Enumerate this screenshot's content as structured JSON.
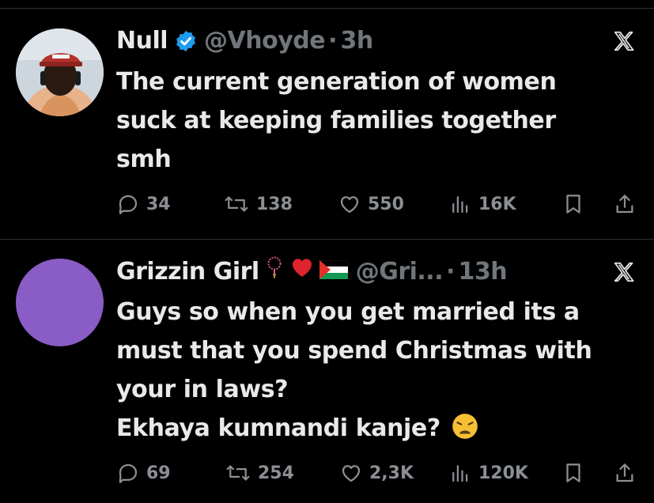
{
  "colors": {
    "background": "#000000",
    "text": "#e7e9ea",
    "muted": "#71767b",
    "verified": "#1d9bf0",
    "divider": "#2f3336",
    "avatar2": "#8a5cc6"
  },
  "tweets": [
    {
      "name": "Null",
      "verified": true,
      "handle": "@Vhoyde",
      "separator": "·",
      "time": "3h",
      "body": [
        "The current generation of women",
        "suck at keeping families together",
        "smh"
      ],
      "replies": "34",
      "reposts": "138",
      "likes": "550",
      "views": "16K",
      "icons": [
        "reply-icon",
        "repost-icon",
        "like-icon",
        "views-icon",
        "bookmark-icon",
        "share-icon",
        "x-logo-icon"
      ]
    },
    {
      "name": "Grizzin Girl",
      "name_emojis": [
        "rosary-emoji",
        "red-heart-emoji",
        "palestine-flag-emoji"
      ],
      "handle": "@Gri...",
      "separator": "·",
      "time": "13h",
      "body": [
        "Guys so when you get married its a",
        "must that you spend Christmas with",
        "your in laws?",
        "Ekhaya kumnandi kanje?"
      ],
      "body_trailing_emoji": "weary-face-emoji",
      "replies": "69",
      "reposts": "254",
      "likes": "2,3K",
      "views": "120K",
      "icons": [
        "reply-icon",
        "repost-icon",
        "like-icon",
        "views-icon",
        "bookmark-icon",
        "share-icon",
        "x-logo-icon"
      ]
    }
  ]
}
